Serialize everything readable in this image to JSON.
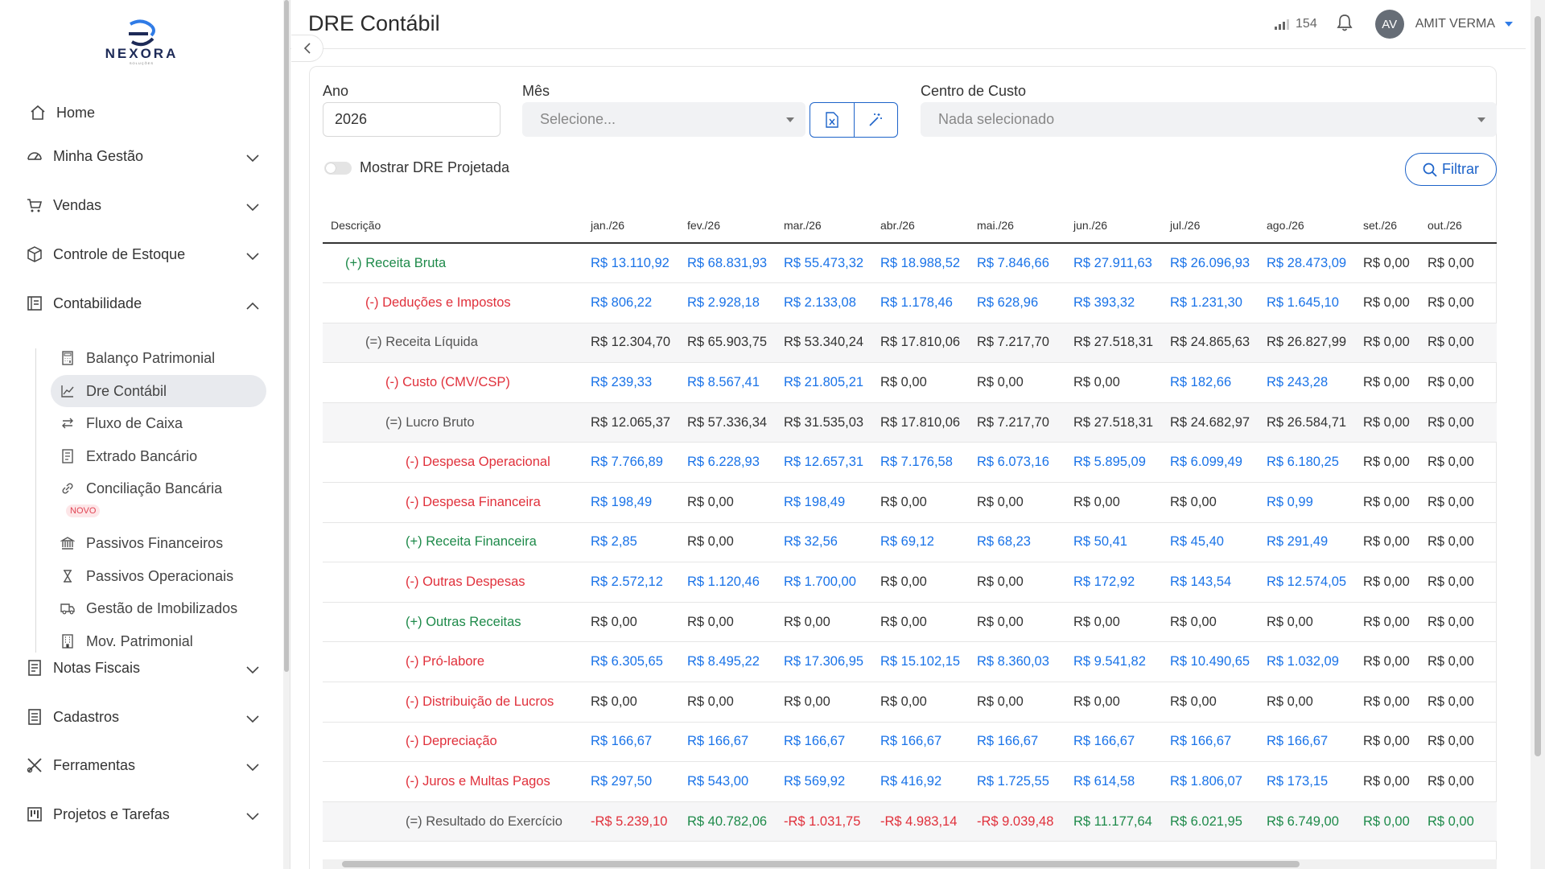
{
  "brand": {
    "name": "NEXORA",
    "sub": "SOLUÇÕES"
  },
  "header": {
    "title": "DRE Contábil",
    "signal_count": "154",
    "avatar_initials": "AV",
    "user_name": "AMIT VERMA"
  },
  "sidebar": {
    "items": [
      {
        "label": "Home",
        "icon": "home-icon"
      },
      {
        "label": "Minha Gestão",
        "icon": "gauge-icon"
      },
      {
        "label": "Vendas",
        "icon": "cart-icon"
      },
      {
        "label": "Controle de Estoque",
        "icon": "box-icon"
      },
      {
        "label": "Contabilidade",
        "icon": "ledger-icon"
      },
      {
        "label": "Notas Fiscais",
        "icon": "receipt-icon"
      },
      {
        "label": "Cadastros",
        "icon": "list-icon"
      },
      {
        "label": "Ferramentas",
        "icon": "tools-icon"
      },
      {
        "label": "Projetos e Tarefas",
        "icon": "kanban-icon"
      }
    ],
    "sub": [
      {
        "label": "Balanço Patrimonial",
        "icon": "calculator-icon"
      },
      {
        "label": "Dre Contábil",
        "icon": "chart-line-icon"
      },
      {
        "label": "Fluxo de Caixa",
        "icon": "arrows-icon"
      },
      {
        "label": "Extrado Bancário",
        "icon": "statement-icon"
      },
      {
        "label": "Conciliação Bancária",
        "icon": "link-icon"
      },
      {
        "label": "Passivos Financeiros",
        "icon": "bank-icon"
      },
      {
        "label": "Passivos Operacionais",
        "icon": "hourglass-icon"
      },
      {
        "label": "Gestão de Imobilizados",
        "icon": "truck-icon"
      },
      {
        "label": "Mov. Patrimonial",
        "icon": "building-icon"
      }
    ],
    "badge_novo": "NOVO"
  },
  "filters": {
    "ano_label": "Ano",
    "ano_value": "2026",
    "mes_label": "Mês",
    "mes_placeholder": "Selecione...",
    "centro_label": "Centro de Custo",
    "centro_placeholder": "Nada selecionado",
    "toggle_label": "Mostrar DRE Projetada",
    "filtrar": "Filtrar"
  },
  "table": {
    "headers": [
      "Descrição",
      "jan./26",
      "fev./26",
      "mar./26",
      "abr./26",
      "mai./26",
      "jun./26",
      "jul./26",
      "ago./26",
      "set./26",
      "out./26"
    ],
    "rows": [
      {
        "desc": "(+) Receita Bruta",
        "kind": "green",
        "indent": 0,
        "gray": false,
        "colors": [
          "blue",
          "blue",
          "blue",
          "blue",
          "blue",
          "blue",
          "blue",
          "blue",
          "black",
          "black"
        ],
        "values": [
          "R$ 13.110,92",
          "R$ 68.831,93",
          "R$ 55.473,32",
          "R$ 18.988,52",
          "R$ 7.846,66",
          "R$ 27.911,63",
          "R$ 26.096,93",
          "R$ 28.473,09",
          "R$ 0,00",
          "R$ 0,00"
        ]
      },
      {
        "desc": "(-) Deduções e Impostos",
        "kind": "red",
        "indent": 1,
        "gray": false,
        "colors": [
          "blue",
          "blue",
          "blue",
          "blue",
          "blue",
          "blue",
          "blue",
          "blue",
          "black",
          "black"
        ],
        "values": [
          "R$ 806,22",
          "R$ 2.928,18",
          "R$ 2.133,08",
          "R$ 1.178,46",
          "R$ 628,96",
          "R$ 393,32",
          "R$ 1.231,30",
          "R$ 1.645,10",
          "R$ 0,00",
          "R$ 0,00"
        ]
      },
      {
        "desc": "(=) Receita Líquida",
        "kind": "gray",
        "indent": 1,
        "gray": true,
        "colors": [
          "black",
          "black",
          "black",
          "black",
          "black",
          "black",
          "black",
          "black",
          "black",
          "black"
        ],
        "values": [
          "R$ 12.304,70",
          "R$ 65.903,75",
          "R$ 53.340,24",
          "R$ 17.810,06",
          "R$ 7.217,70",
          "R$ 27.518,31",
          "R$ 24.865,63",
          "R$ 26.827,99",
          "R$ 0,00",
          "R$ 0,00"
        ]
      },
      {
        "desc": "(-) Custo (CMV/CSP)",
        "kind": "red",
        "indent": 2,
        "gray": false,
        "colors": [
          "blue",
          "blue",
          "blue",
          "black",
          "black",
          "black",
          "blue",
          "blue",
          "black",
          "black"
        ],
        "values": [
          "R$ 239,33",
          "R$ 8.567,41",
          "R$ 21.805,21",
          "R$ 0,00",
          "R$ 0,00",
          "R$ 0,00",
          "R$ 182,66",
          "R$ 243,28",
          "R$ 0,00",
          "R$ 0,00"
        ]
      },
      {
        "desc": "(=) Lucro Bruto",
        "kind": "gray",
        "indent": 2,
        "gray": true,
        "colors": [
          "black",
          "black",
          "black",
          "black",
          "black",
          "black",
          "black",
          "black",
          "black",
          "black"
        ],
        "values": [
          "R$ 12.065,37",
          "R$ 57.336,34",
          "R$ 31.535,03",
          "R$ 17.810,06",
          "R$ 7.217,70",
          "R$ 27.518,31",
          "R$ 24.682,97",
          "R$ 26.584,71",
          "R$ 0,00",
          "R$ 0,00"
        ]
      },
      {
        "desc": "(-) Despesa Operacional",
        "kind": "red",
        "indent": 3,
        "gray": false,
        "colors": [
          "blue",
          "blue",
          "blue",
          "blue",
          "blue",
          "blue",
          "blue",
          "blue",
          "black",
          "black"
        ],
        "values": [
          "R$ 7.766,89",
          "R$ 6.228,93",
          "R$ 12.657,31",
          "R$ 7.176,58",
          "R$ 6.073,16",
          "R$ 5.895,09",
          "R$ 6.099,49",
          "R$ 6.180,25",
          "R$ 0,00",
          "R$ 0,00"
        ]
      },
      {
        "desc": "(-) Despesa Financeira",
        "kind": "red",
        "indent": 3,
        "gray": false,
        "colors": [
          "blue",
          "black",
          "blue",
          "black",
          "black",
          "black",
          "black",
          "blue",
          "black",
          "black"
        ],
        "values": [
          "R$ 198,49",
          "R$ 0,00",
          "R$ 198,49",
          "R$ 0,00",
          "R$ 0,00",
          "R$ 0,00",
          "R$ 0,00",
          "R$ 0,99",
          "R$ 0,00",
          "R$ 0,00"
        ]
      },
      {
        "desc": "(+) Receita Financeira",
        "kind": "green",
        "indent": 3,
        "gray": false,
        "colors": [
          "blue",
          "black",
          "blue",
          "blue",
          "blue",
          "blue",
          "blue",
          "blue",
          "black",
          "black"
        ],
        "values": [
          "R$ 2,85",
          "R$ 0,00",
          "R$ 32,56",
          "R$ 69,12",
          "R$ 68,23",
          "R$ 50,41",
          "R$ 45,40",
          "R$ 291,49",
          "R$ 0,00",
          "R$ 0,00"
        ]
      },
      {
        "desc": "(-) Outras Despesas",
        "kind": "red",
        "indent": 3,
        "gray": false,
        "colors": [
          "blue",
          "blue",
          "blue",
          "black",
          "black",
          "blue",
          "blue",
          "blue",
          "black",
          "black"
        ],
        "values": [
          "R$ 2.572,12",
          "R$ 1.120,46",
          "R$ 1.700,00",
          "R$ 0,00",
          "R$ 0,00",
          "R$ 172,92",
          "R$ 143,54",
          "R$ 12.574,05",
          "R$ 0,00",
          "R$ 0,00"
        ]
      },
      {
        "desc": "(+) Outras Receitas",
        "kind": "green",
        "indent": 3,
        "gray": false,
        "colors": [
          "black",
          "black",
          "black",
          "black",
          "black",
          "black",
          "black",
          "black",
          "black",
          "black"
        ],
        "values": [
          "R$ 0,00",
          "R$ 0,00",
          "R$ 0,00",
          "R$ 0,00",
          "R$ 0,00",
          "R$ 0,00",
          "R$ 0,00",
          "R$ 0,00",
          "R$ 0,00",
          "R$ 0,00"
        ]
      },
      {
        "desc": "(-) Pró-labore",
        "kind": "red",
        "indent": 3,
        "gray": false,
        "colors": [
          "blue",
          "blue",
          "blue",
          "blue",
          "blue",
          "blue",
          "blue",
          "blue",
          "black",
          "black"
        ],
        "values": [
          "R$ 6.305,65",
          "R$ 8.495,22",
          "R$ 17.306,95",
          "R$ 15.102,15",
          "R$ 8.360,03",
          "R$ 9.541,82",
          "R$ 10.490,65",
          "R$ 1.032,09",
          "R$ 0,00",
          "R$ 0,00"
        ]
      },
      {
        "desc": "(-) Distribuição de Lucros",
        "kind": "red",
        "indent": 3,
        "gray": false,
        "colors": [
          "black",
          "black",
          "black",
          "black",
          "black",
          "black",
          "black",
          "black",
          "black",
          "black"
        ],
        "values": [
          "R$ 0,00",
          "R$ 0,00",
          "R$ 0,00",
          "R$ 0,00",
          "R$ 0,00",
          "R$ 0,00",
          "R$ 0,00",
          "R$ 0,00",
          "R$ 0,00",
          "R$ 0,00"
        ]
      },
      {
        "desc": "(-) Depreciação",
        "kind": "red",
        "indent": 3,
        "gray": false,
        "colors": [
          "blue",
          "blue",
          "blue",
          "blue",
          "blue",
          "blue",
          "blue",
          "blue",
          "black",
          "black"
        ],
        "values": [
          "R$ 166,67",
          "R$ 166,67",
          "R$ 166,67",
          "R$ 166,67",
          "R$ 166,67",
          "R$ 166,67",
          "R$ 166,67",
          "R$ 166,67",
          "R$ 0,00",
          "R$ 0,00"
        ]
      },
      {
        "desc": "(-) Juros e Multas Pagos",
        "kind": "red",
        "indent": 3,
        "gray": false,
        "colors": [
          "blue",
          "blue",
          "blue",
          "blue",
          "blue",
          "blue",
          "blue",
          "blue",
          "black",
          "black"
        ],
        "values": [
          "R$ 297,50",
          "R$ 543,00",
          "R$ 569,92",
          "R$ 416,92",
          "R$ 1.725,55",
          "R$ 614,58",
          "R$ 1.806,07",
          "R$ 173,15",
          "R$ 0,00",
          "R$ 0,00"
        ]
      },
      {
        "desc": "(=) Resultado do Exercício",
        "kind": "gray",
        "indent": 3,
        "gray": true,
        "colors": [
          "red",
          "green",
          "red",
          "red",
          "red",
          "green",
          "green",
          "green",
          "green",
          "green"
        ],
        "values": [
          "-R$ 5.239,10",
          "R$ 40.782,06",
          "-R$ 1.031,75",
          "-R$ 4.983,14",
          "-R$ 9.039,48",
          "R$ 11.177,64",
          "R$ 6.021,95",
          "R$ 6.749,00",
          "R$ 0,00",
          "R$ 0,00"
        ]
      }
    ]
  },
  "colors": {
    "accent": "#1d63c9",
    "blue_value": "#1a73e8",
    "red": "#e0303b",
    "green": "#1e8a4a"
  }
}
